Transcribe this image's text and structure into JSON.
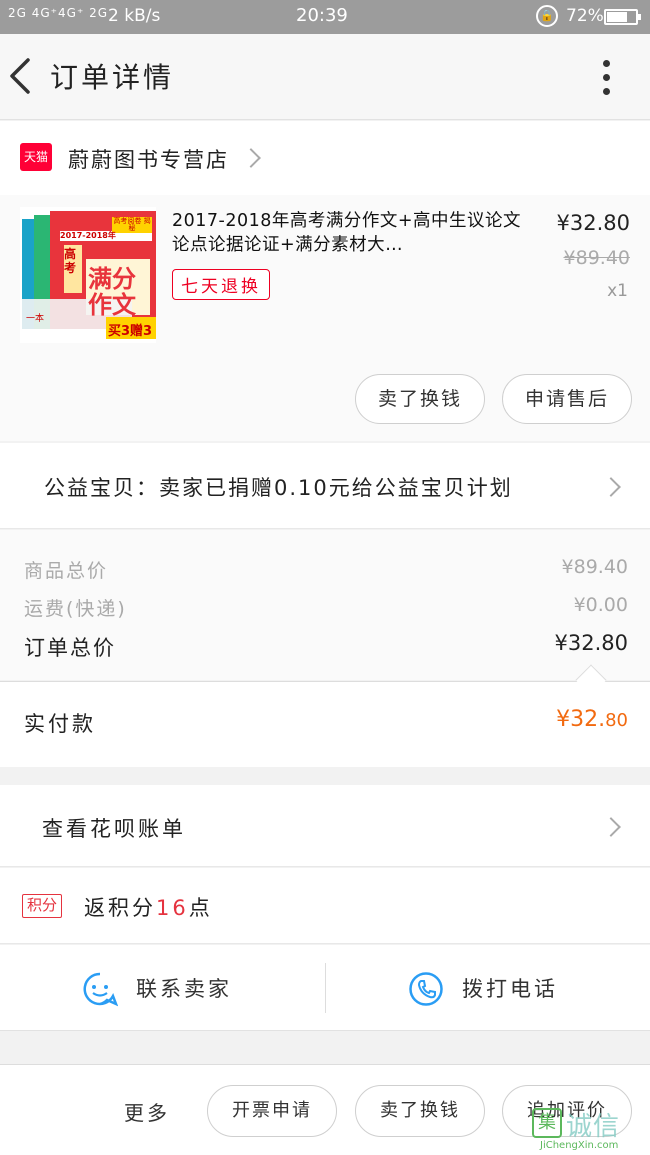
{
  "status_bar": {
    "signal": "2G 4G⁺4G⁺ 2G",
    "speed": "2 kB/s",
    "time": "20:39",
    "battery": "72%",
    "battery_level": 0.72
  },
  "header": {
    "title": "订单详情"
  },
  "shop": {
    "badge": "天猫",
    "name": "蔚蔚图书专营店"
  },
  "product": {
    "title": "2017-2018年高考满分作文+高中生议论文论点论据论证+满分素材大…",
    "tag": "七天退换",
    "price": "¥32.80",
    "original_price": "¥89.40",
    "quantity": "x1",
    "image": {
      "year_band": "2017-2018年",
      "top_badge": "高考阅卷 揭秘",
      "main_text_1": "满分",
      "main_text_2": "作文",
      "side_text": "高考",
      "promo": "买3赠3",
      "brand": "一本"
    },
    "buttons": {
      "refund": "卖了换钱",
      "after_sale": "申请售后"
    }
  },
  "charity": {
    "text": "公益宝贝：卖家已捐赠0.10元给公益宝贝计划"
  },
  "summary": {
    "goods_total_label": "商品总价",
    "goods_total_value": "¥89.40",
    "shipping_label": "运费(快递)",
    "shipping_value": "¥0.00",
    "order_total_label": "订单总价",
    "order_total_value": "¥32.80"
  },
  "actual_payment": {
    "label": "实付款",
    "value_main": "¥32.",
    "value_cents": "80"
  },
  "huabei": {
    "label": "查看花呗账单"
  },
  "points": {
    "badge": "积分",
    "prefix": "返积分",
    "number": "16",
    "suffix": "点"
  },
  "contact": {
    "seller": "联系卖家",
    "phone": "拨打电话"
  },
  "bottom": {
    "more": "更多",
    "invoice": "开票申请",
    "sell": "卖了换钱",
    "review": "追加评价"
  },
  "watermark": {
    "box": "集",
    "big": "诚信",
    "small": "JiChengXin.com"
  },
  "colors": {
    "accent_red": "#ff0036",
    "price_orange": "#f26a10",
    "icon_blue": "#2a9df4"
  }
}
